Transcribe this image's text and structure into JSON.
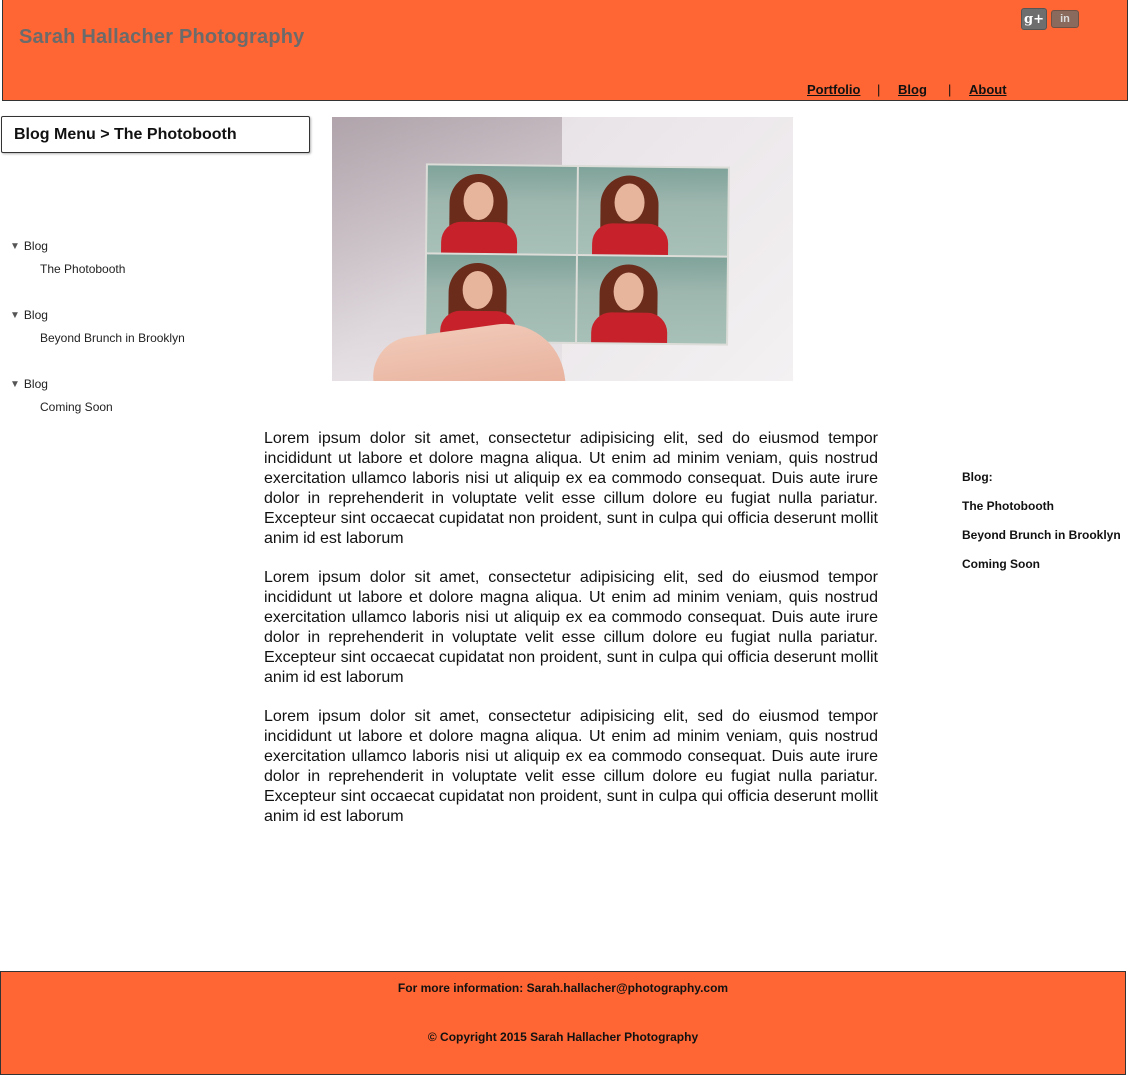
{
  "header": {
    "title": "Sarah Hallacher Photography",
    "social": {
      "gplus_text": "g+",
      "linkedin_text": "in"
    },
    "nav": {
      "portfolio": "Portfolio",
      "sep1": "|",
      "blog": " Blog",
      "sep2": "|",
      "about": " About"
    }
  },
  "breadcrumb": "Blog Menu > The Photobooth",
  "tree": [
    {
      "head": "Blog",
      "item": "The Photobooth"
    },
    {
      "head": "Blog",
      "item": "Beyond Brunch in Brooklyn"
    },
    {
      "head": "Blog",
      "item": "Coming Soon"
    }
  ],
  "paragraphs": [
    "Lorem ipsum dolor sit amet, consectetur adipisicing elit, sed do eiusmod tempor incididunt ut labore et dolore magna aliqua. Ut enim ad minim veniam, quis nostrud exercitation ullamco laboris nisi ut aliquip ex ea commodo consequat. Duis aute irure dolor in reprehenderit in voluptate velit esse cillum dolore eu fugiat nulla pariatur. Excepteur sint occaecat cupidatat non proident, sunt in culpa qui officia deserunt mollit anim id est laborum",
    "Lorem ipsum dolor sit amet, consectetur adipisicing elit, sed do eiusmod tempor incididunt ut labore et dolore magna aliqua. Ut enim ad minim veniam, quis nostrud exercitation ullamco laboris nisi ut aliquip ex ea commodo consequat. Duis aute irure dolor in reprehenderit in voluptate velit esse cillum dolore eu fugiat nulla pariatur. Excepteur sint occaecat cupidatat non proident, sunt in culpa qui officia deserunt mollit anim id est laborum",
    "Lorem ipsum dolor sit amet, consectetur adipisicing elit, sed do eiusmod tempor incididunt ut labore et dolore magna aliqua. Ut enim ad minim veniam, quis nostrud exercitation ullamco laboris nisi ut aliquip ex ea commodo consequat. Duis aute irure dolor in reprehenderit in voluptate velit esse cillum dolore eu fugiat nulla pariatur. Excepteur sint occaecat cupidatat non proident, sunt in culpa qui officia deserunt mollit anim id est laborum"
  ],
  "sidebar": {
    "heading": "Blog:",
    "links": [
      "The Photobooth",
      "Beyond Brunch in Brooklyn",
      "Coming Soon"
    ]
  },
  "footer": {
    "info": "For more information: Sarah.hallacher@photography.com",
    "copyright": "© Copyright 2015 Sarah Hallacher Photography"
  },
  "colors": {
    "brand": "#ff6633",
    "title_gray": "#6b6b6b"
  }
}
